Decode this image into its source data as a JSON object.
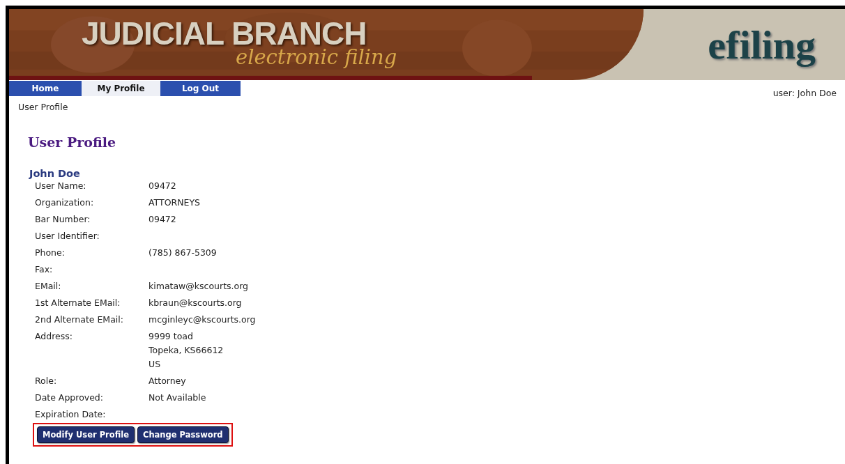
{
  "banner": {
    "title": "JUDICIAL BRANCH",
    "subtitle": "electronic filing",
    "logo": "efiling"
  },
  "tabs": [
    {
      "label": "Home",
      "selected": false
    },
    {
      "label": "My Profile",
      "selected": true
    },
    {
      "label": "Log Out",
      "selected": false
    }
  ],
  "user_label": "user: John Doe",
  "breadcrumb": "User Profile",
  "heading": "User Profile",
  "profile": {
    "name": "John Doe",
    "fields": [
      {
        "label": "User Name:",
        "value": "09472"
      },
      {
        "label": "Organization:",
        "value": "ATTORNEYS"
      },
      {
        "label": "Bar Number:",
        "value": "09472"
      },
      {
        "label": "User Identifier:"
      },
      {
        "label": "Phone:",
        "value": "(785) 867-5309"
      },
      {
        "label": "Fax:"
      },
      {
        "label": "EMail:",
        "value": "kimataw@kscourts.org"
      },
      {
        "label": "1st Alternate EMail:",
        "value": "kbraun@kscourts.org"
      },
      {
        "label": "2nd Alternate EMail:",
        "value": "mcginleyc@kscourts.org"
      },
      {
        "label": "Address:",
        "value": "9999 toad\nTopeka, KS66612\nUS"
      },
      {
        "label": "Role:",
        "value": " Attorney"
      },
      {
        "label": "Date Approved:",
        "value": "Not Available"
      },
      {
        "label": "Expiration Date:"
      }
    ]
  },
  "buttons": [
    "Modify User Profile",
    "Change Password"
  ]
}
